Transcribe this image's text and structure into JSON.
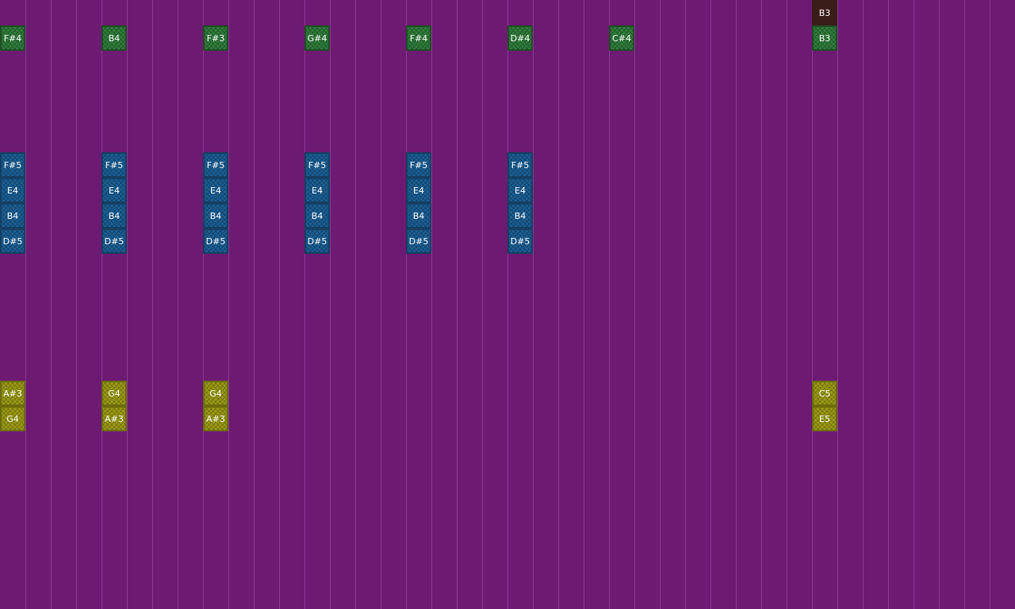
{
  "grid": {
    "columns": 40,
    "rows": 24
  },
  "colors": {
    "background": "#6c1a72",
    "green": "#2f7d3b",
    "blue": "#1b5f95",
    "yellow": "#9a9a14",
    "dark": "#3a1c18"
  },
  "notes": [
    {
      "label": "B3",
      "color": "dark",
      "col": 32,
      "row": 0
    },
    {
      "label": "F#4",
      "color": "green",
      "col": 0,
      "row": 1
    },
    {
      "label": "B4",
      "color": "green",
      "col": 4,
      "row": 1
    },
    {
      "label": "F#3",
      "color": "green",
      "col": 8,
      "row": 1
    },
    {
      "label": "G#4",
      "color": "green",
      "col": 12,
      "row": 1
    },
    {
      "label": "F#4",
      "color": "green",
      "col": 16,
      "row": 1
    },
    {
      "label": "D#4",
      "color": "green",
      "col": 20,
      "row": 1
    },
    {
      "label": "C#4",
      "color": "green",
      "col": 24,
      "row": 1
    },
    {
      "label": "B3",
      "color": "green",
      "col": 32,
      "row": 1
    },
    {
      "label": "F#5",
      "color": "blue",
      "col": 0,
      "row": 6
    },
    {
      "label": "E4",
      "color": "blue",
      "col": 0,
      "row": 7
    },
    {
      "label": "B4",
      "color": "blue",
      "col": 0,
      "row": 8
    },
    {
      "label": "D#5",
      "color": "blue",
      "col": 0,
      "row": 9
    },
    {
      "label": "F#5",
      "color": "blue",
      "col": 4,
      "row": 6
    },
    {
      "label": "E4",
      "color": "blue",
      "col": 4,
      "row": 7
    },
    {
      "label": "B4",
      "color": "blue",
      "col": 4,
      "row": 8
    },
    {
      "label": "D#5",
      "color": "blue",
      "col": 4,
      "row": 9
    },
    {
      "label": "F#5",
      "color": "blue",
      "col": 8,
      "row": 6
    },
    {
      "label": "E4",
      "color": "blue",
      "col": 8,
      "row": 7
    },
    {
      "label": "B4",
      "color": "blue",
      "col": 8,
      "row": 8
    },
    {
      "label": "D#5",
      "color": "blue",
      "col": 8,
      "row": 9
    },
    {
      "label": "F#5",
      "color": "blue",
      "col": 12,
      "row": 6
    },
    {
      "label": "E4",
      "color": "blue",
      "col": 12,
      "row": 7
    },
    {
      "label": "B4",
      "color": "blue",
      "col": 12,
      "row": 8
    },
    {
      "label": "D#5",
      "color": "blue",
      "col": 12,
      "row": 9
    },
    {
      "label": "F#5",
      "color": "blue",
      "col": 16,
      "row": 6
    },
    {
      "label": "E4",
      "color": "blue",
      "col": 16,
      "row": 7
    },
    {
      "label": "B4",
      "color": "blue",
      "col": 16,
      "row": 8
    },
    {
      "label": "D#5",
      "color": "blue",
      "col": 16,
      "row": 9
    },
    {
      "label": "F#5",
      "color": "blue",
      "col": 20,
      "row": 6
    },
    {
      "label": "E4",
      "color": "blue",
      "col": 20,
      "row": 7
    },
    {
      "label": "B4",
      "color": "blue",
      "col": 20,
      "row": 8
    },
    {
      "label": "D#5",
      "color": "blue",
      "col": 20,
      "row": 9
    },
    {
      "label": "A#3",
      "color": "yellow",
      "col": 0,
      "row": 15
    },
    {
      "label": "G4",
      "color": "yellow",
      "col": 0,
      "row": 16
    },
    {
      "label": "G4",
      "color": "yellow",
      "col": 4,
      "row": 15
    },
    {
      "label": "A#3",
      "color": "yellow",
      "col": 4,
      "row": 16
    },
    {
      "label": "G4",
      "color": "yellow",
      "col": 8,
      "row": 15
    },
    {
      "label": "A#3",
      "color": "yellow",
      "col": 8,
      "row": 16
    },
    {
      "label": "C5",
      "color": "yellow",
      "col": 32,
      "row": 15
    },
    {
      "label": "E5",
      "color": "yellow",
      "col": 32,
      "row": 16
    }
  ]
}
